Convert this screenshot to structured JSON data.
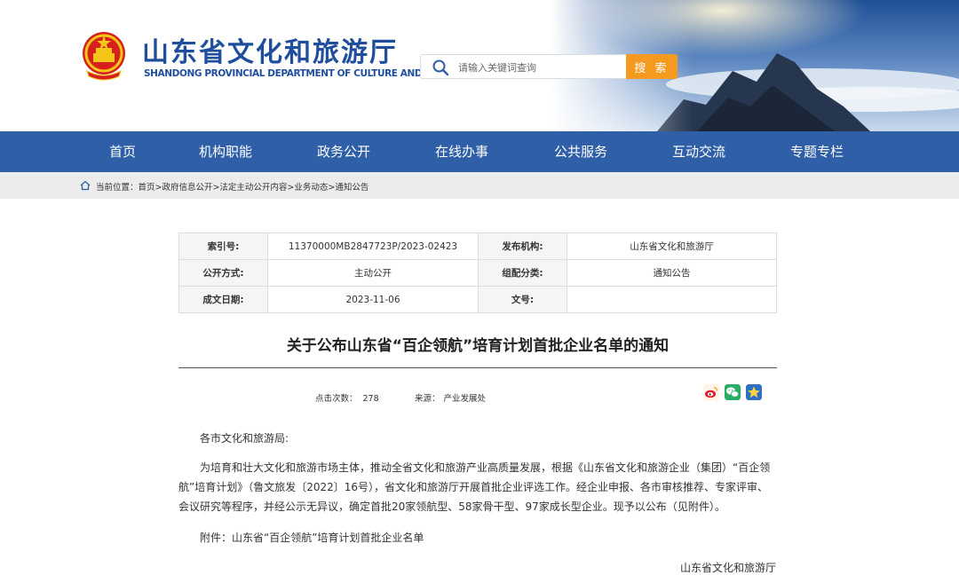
{
  "header": {
    "title": "山东省文化和旅游厅",
    "subtitle": "SHANDONG PROVINCIAL DEPARTMENT OF CULTURE AND TOURISM",
    "search_placeholder": "请输入关键词查询",
    "search_button": "搜 索"
  },
  "nav": {
    "items": [
      "首页",
      "机构职能",
      "政务公开",
      "在线办事",
      "公共服务",
      "互动交流",
      "专题专栏"
    ]
  },
  "breadcrumb": {
    "text": "当前位置：首页>政府信息公开>法定主动公开内容>业务动态>通知公告"
  },
  "info": {
    "index_label": "索引号:",
    "index_value": "11370000MB2847723P/2023-02423",
    "publisher_label": "发布机构:",
    "publisher_value": "山东省文化和旅游厅",
    "method_label": "公开方式:",
    "method_value": "主动公开",
    "category_label": "组配分类:",
    "category_value": "通知公告",
    "date_label": "成文日期:",
    "date_value": "2023-11-06",
    "docno_label": "文号:",
    "docno_value": ""
  },
  "article": {
    "title": "关于公布山东省“百企领航”培育计划首批企业名单的通知",
    "clicks_label": "点击次数：",
    "clicks_value": "278",
    "source_label": "来源：",
    "source_value": "产业发展处",
    "greeting": "各市文化和旅游局:",
    "paragraph": "为培育和壮大文化和旅游市场主体，推动全省文化和旅游产业高质量发展，根据《山东省文化和旅游企业（集团）“百企领航”培育计划》（鲁文旅发〔2022〕16号），省文化和旅游厅开展首批企业评选工作。经企业申报、各市审核推荐、专家评审、会议研究等程序，并经公示无异议，确定首批20家领航型、58家骨干型、97家成长型企业。现予以公布（见附件）。",
    "attachment": "附件：山东省“百企领航”培育计划首批企业名单",
    "signature": "山东省文化和旅游厅"
  },
  "colors": {
    "brand_blue": "#1f4e9c",
    "nav_blue": "#2f5fa7",
    "search_orange": "#f39a1f"
  },
  "icons": [
    "emblem-icon",
    "search-icon",
    "home-icon",
    "weibo-icon",
    "wechat-icon",
    "favorite-icon"
  ]
}
